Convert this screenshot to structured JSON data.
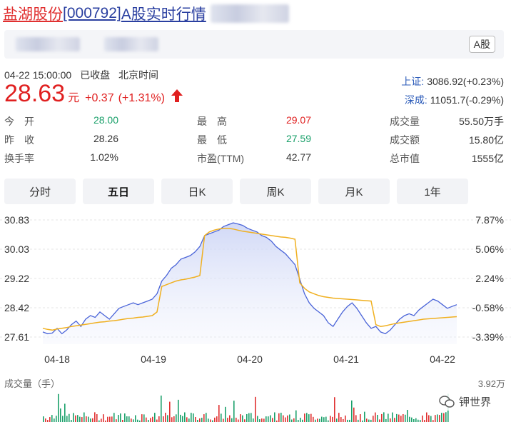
{
  "header": {
    "stock_name": "盐湖股份",
    "stock_code": "[000792]",
    "title_suffix": "A股实时行情"
  },
  "info_bar": {
    "badge": "A股"
  },
  "status": {
    "datetime": "04-22 15:00:00",
    "state": "已收盘",
    "timezone": "北京时间"
  },
  "quote": {
    "price": "28.63",
    "unit": "元",
    "change": "+0.37",
    "change_pct": "(+1.31%)"
  },
  "indices": [
    {
      "label": "上证:",
      "value": "3086.92(+0.23%)"
    },
    {
      "label": "深成:",
      "value": "11051.7(-0.29%)"
    }
  ],
  "stats": [
    [
      {
        "label": "今　开",
        "value": "28.00",
        "color": "#1aa06a"
      },
      {
        "label": "最　高",
        "value": "29.07",
        "color": "#e02020"
      },
      {
        "label": "成交量",
        "value": "55.50万手",
        "color": "#333333"
      }
    ],
    [
      {
        "label": "昨　收",
        "value": "28.26",
        "color": "#333333"
      },
      {
        "label": "最　低",
        "value": "27.59",
        "color": "#1aa06a"
      },
      {
        "label": "成交额",
        "value": "15.80亿",
        "color": "#333333"
      }
    ],
    [
      {
        "label": "换手率",
        "value": "1.02%",
        "color": "#333333"
      },
      {
        "label": "市盈(TTM)",
        "value": "42.77",
        "color": "#333333"
      },
      {
        "label": "总市值",
        "value": "1555亿",
        "color": "#333333"
      }
    ]
  ],
  "tabs": [
    {
      "label": "分时",
      "active": false
    },
    {
      "label": "五日",
      "active": true
    },
    {
      "label": "日K",
      "active": false
    },
    {
      "label": "周K",
      "active": false
    },
    {
      "label": "月K",
      "active": false
    },
    {
      "label": "1年",
      "active": false
    }
  ],
  "chart_data": {
    "type": "line",
    "title": "",
    "y_left_ticks": [
      "30.83",
      "30.03",
      "29.22",
      "28.42",
      "27.61"
    ],
    "y_right_ticks": [
      "7.87%",
      "5.06%",
      "2.24%",
      "-0.58%",
      "-3.39%"
    ],
    "ylim": [
      27.61,
      30.83
    ],
    "x_ticks": [
      "04-18",
      "04-19",
      "04-20",
      "04-21",
      "04-22"
    ],
    "series": [
      {
        "name": "",
        "color": "#4a64d8",
        "values": [
          27.75,
          27.7,
          27.72,
          27.85,
          27.7,
          27.8,
          27.95,
          28.05,
          27.9,
          28.1,
          28.2,
          28.15,
          28.3,
          28.2,
          28.1,
          28.25,
          28.4,
          28.45,
          28.5,
          28.55,
          28.5,
          28.55,
          28.6,
          28.65,
          28.8,
          29.15,
          29.3,
          29.5,
          29.6,
          29.75,
          29.8,
          29.85,
          29.95,
          30.1,
          30.4,
          30.45,
          30.5,
          30.55,
          30.65,
          30.7,
          30.75,
          30.72,
          30.68,
          30.6,
          30.55,
          30.5,
          30.4,
          30.35,
          30.25,
          30.1,
          30.0,
          29.9,
          29.75,
          29.6,
          29.2,
          28.8,
          28.55,
          28.4,
          28.3,
          28.2,
          28.0,
          27.9,
          28.1,
          28.3,
          28.45,
          28.55,
          28.4,
          28.2,
          28.0,
          27.85,
          27.9,
          27.75,
          27.7,
          27.8,
          27.95,
          28.1,
          28.2,
          28.25,
          28.2,
          28.35,
          28.45,
          28.55,
          28.65,
          28.6,
          28.5,
          28.4,
          28.45,
          28.5
        ]
      },
      {
        "name": "",
        "color": "#f0b020",
        "values": [
          27.85,
          27.82,
          27.8,
          27.83,
          27.85,
          27.87,
          27.9,
          27.92,
          27.94,
          27.96,
          27.98,
          28.0,
          28.02,
          28.03,
          28.05,
          28.06,
          28.08,
          28.1,
          28.12,
          28.13,
          28.15,
          28.16,
          28.18,
          28.2,
          28.3,
          29.0,
          29.05,
          29.1,
          29.15,
          29.18,
          29.2,
          29.23,
          29.26,
          29.3,
          30.4,
          30.5,
          30.55,
          30.58,
          30.6,
          30.6,
          30.58,
          30.55,
          30.52,
          30.5,
          30.48,
          30.46,
          30.44,
          30.42,
          30.4,
          30.38,
          30.36,
          30.35,
          30.33,
          30.3,
          29.1,
          28.95,
          28.85,
          28.8,
          28.75,
          28.72,
          28.7,
          28.68,
          28.67,
          28.66,
          28.65,
          28.64,
          28.63,
          28.62,
          28.61,
          28.6,
          27.95,
          27.9,
          27.92,
          27.95,
          27.98,
          28.0,
          28.02,
          28.04,
          28.06,
          28.08,
          28.1,
          28.11,
          28.12,
          28.13,
          28.14,
          28.15,
          28.16,
          28.17
        ]
      }
    ],
    "volume_label": "成交量（手）",
    "volume_max": "3.92万"
  },
  "watermark": {
    "text": "钾世界"
  },
  "colors": {
    "up": "#e02020",
    "down": "#1aa06a",
    "link": "#2a3fa0"
  }
}
